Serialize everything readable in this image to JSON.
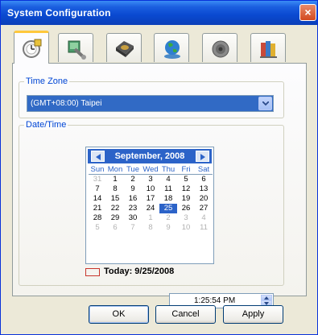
{
  "window": {
    "title": "System Configuration",
    "close_glyph": "×"
  },
  "tabs": [
    {
      "icon": "clock-settings-icon",
      "active": true
    },
    {
      "icon": "tools-icon",
      "active": false
    },
    {
      "icon": "hard-drive-icon",
      "active": false
    },
    {
      "icon": "globe-network-icon",
      "active": false
    },
    {
      "icon": "speaker-icon",
      "active": false
    },
    {
      "icon": "books-icon",
      "active": false
    }
  ],
  "timezone": {
    "label": "Time Zone",
    "value": "(GMT+08:00) Taipei"
  },
  "datetime": {
    "label": "Date/Time",
    "month_label": "September, 2008",
    "days_of_week": [
      "Sun",
      "Mon",
      "Tue",
      "Wed",
      "Thu",
      "Fri",
      "Sat"
    ],
    "weeks": [
      [
        "31",
        "1",
        "2",
        "3",
        "4",
        "5",
        "6"
      ],
      [
        "7",
        "8",
        "9",
        "10",
        "11",
        "12",
        "13"
      ],
      [
        "14",
        "15",
        "16",
        "17",
        "18",
        "19",
        "20"
      ],
      [
        "21",
        "22",
        "23",
        "24",
        "25",
        "26",
        "27"
      ],
      [
        "28",
        "29",
        "30",
        "1",
        "2",
        "3",
        "4"
      ],
      [
        "5",
        "6",
        "7",
        "8",
        "9",
        "10",
        "11"
      ]
    ],
    "selected_day": "25",
    "today_text": "Today: 9/25/2008",
    "time": "1:25:54 PM"
  },
  "buttons": {
    "ok": "OK",
    "cancel": "Cancel",
    "apply": "Apply"
  },
  "colors": {
    "accent": "#2c63c8",
    "title_bar": "#0a49d0",
    "today_marker": "#c8362d"
  }
}
